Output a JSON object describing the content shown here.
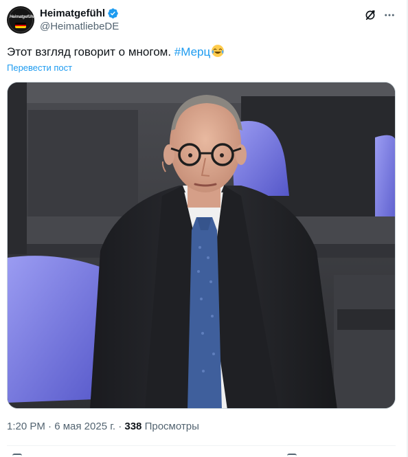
{
  "author": {
    "display_name": "Heimatgefühl",
    "handle": "@HeimatliebeDE",
    "avatar_logo_text": "Heimatgefühl",
    "verified": true,
    "verified_icon": "verified-badge-icon",
    "flag_colors": [
      "#000000",
      "#dd0000",
      "#ffce00"
    ]
  },
  "header_actions": {
    "grok_icon": "grok-icon",
    "more_icon": "more-horizontal-icon"
  },
  "post": {
    "text": "Этот взгляд говорит о многом. ",
    "hashtag": "#Мерц",
    "emoji": "face-with-tears-of-joy",
    "translate_label": "Перевести пост"
  },
  "media": {
    "type": "photo",
    "subject": "man in dark suit and blue tie standing in parliament hall with purple seats"
  },
  "meta": {
    "time": "1:20 PM",
    "separator": " · ",
    "date": "6 мая 2025 г.",
    "views_count": "338",
    "views_label": " Просмотры"
  },
  "colors": {
    "accent": "#1d9bf0",
    "text_primary": "#0f1419",
    "text_secondary": "#536471",
    "border": "#cfd9de"
  }
}
